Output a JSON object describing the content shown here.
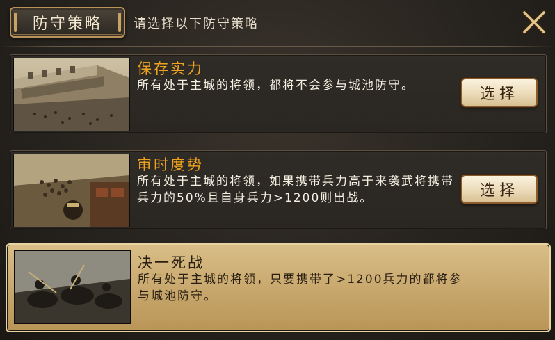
{
  "header": {
    "title": "防守策略",
    "subtitle": "请选择以下防守策略",
    "close_icon": "close-x-icon"
  },
  "strategies": [
    {
      "name": "保存实力",
      "description": "所有处于主城的将领，都将不会参与城池防守。",
      "button_label": "选择",
      "selected": false,
      "thumbnail": "city-wall-battle-image"
    },
    {
      "name": "审时度势",
      "description": "所有处于主城的将领，如果携带兵力高于来袭武将携带兵力的50%且自身兵力>1200则出战。",
      "button_label": "选择",
      "selected": false,
      "thumbnail": "army-march-image"
    },
    {
      "name": "决一死战",
      "description": "所有处于主城的将领，只要携带了>1200兵力的都将参与城池防守。",
      "selected": true,
      "thumbnail": "cavalry-charge-image"
    }
  ],
  "colors": {
    "accent_gold": "#f0a41e",
    "selected_bg": "#c5a469",
    "panel_bg": "#2a2621"
  }
}
